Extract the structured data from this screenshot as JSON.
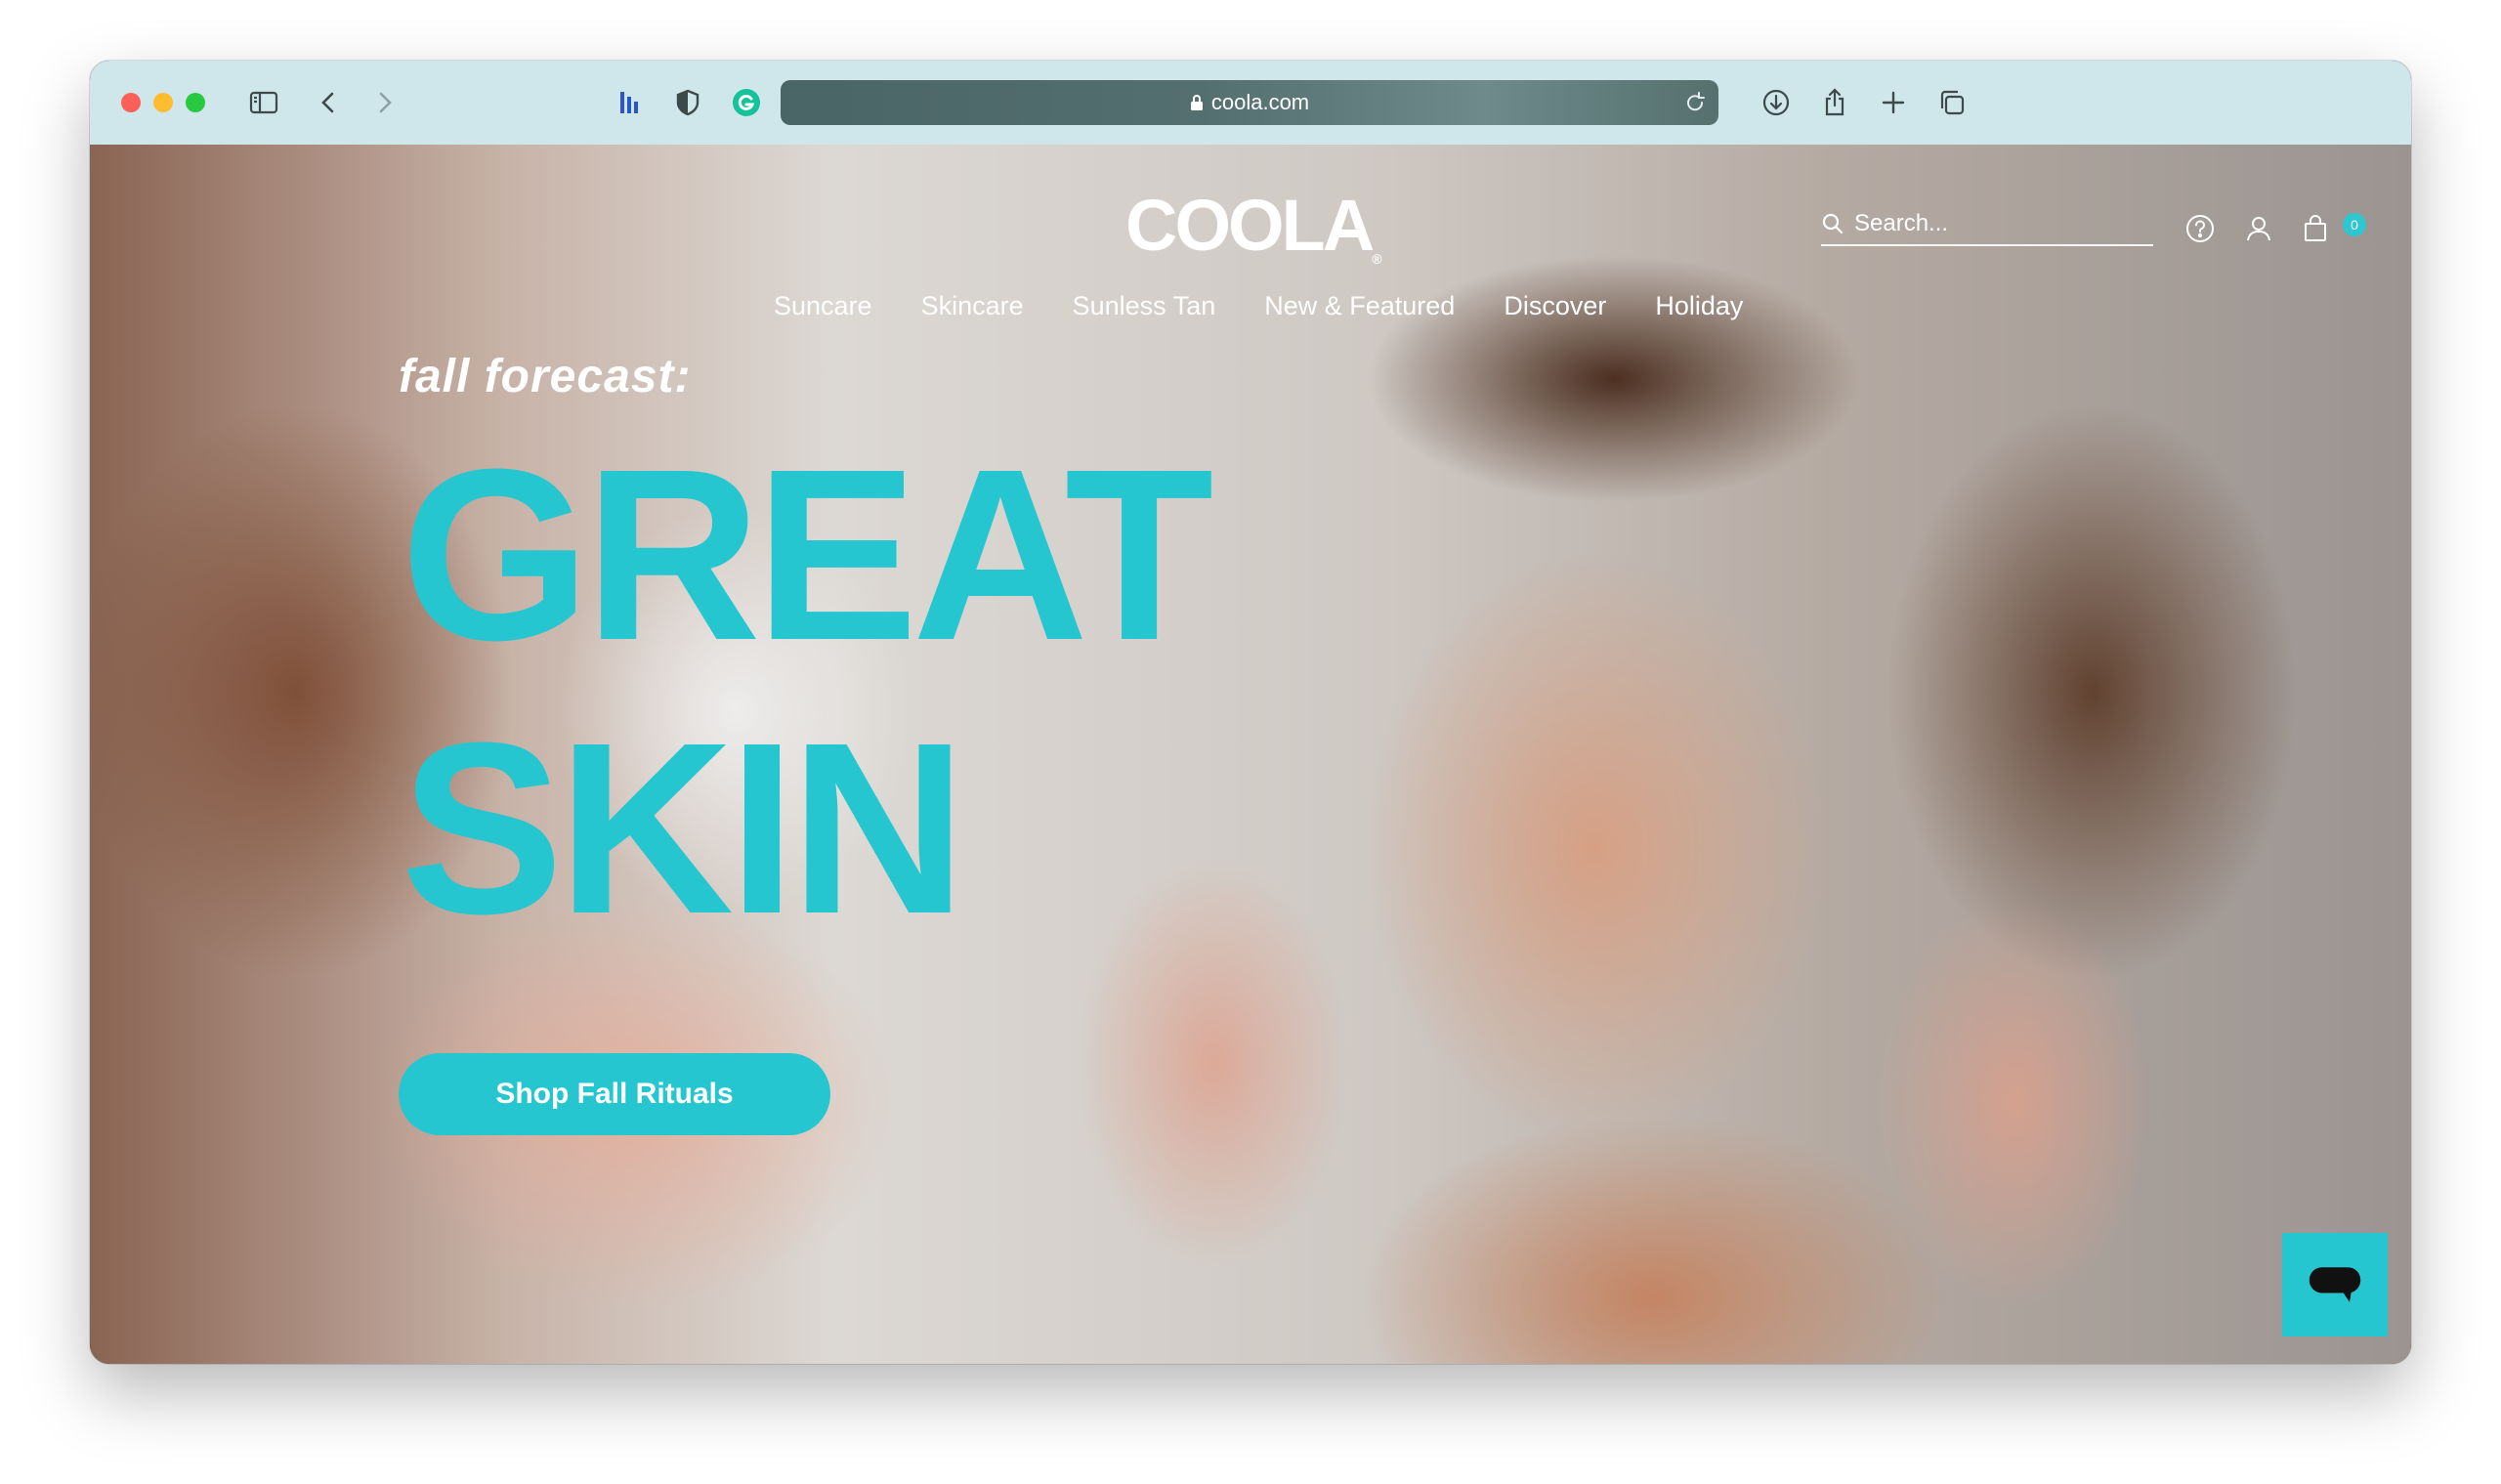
{
  "browser": {
    "url": "coola.com",
    "icons": [
      "sidebar-icon",
      "back-icon",
      "forward-icon",
      "extension-bars-icon",
      "privacy-shield-icon",
      "grammarly-icon",
      "lock-icon",
      "reload-icon",
      "download-icon",
      "share-icon",
      "new-tab-icon",
      "tab-overview-icon"
    ]
  },
  "site": {
    "logo": "COOLA",
    "logo_mark": "®",
    "nav": [
      "Suncare",
      "Skincare",
      "Sunless Tan",
      "New & Featured",
      "Discover",
      "Holiday"
    ],
    "search_placeholder": "Search...",
    "cart_count": "0",
    "header_icons": [
      "search-icon",
      "help-icon",
      "account-icon",
      "cart-icon"
    ]
  },
  "hero": {
    "kicker": "fall forecast:",
    "headline_line1": "GREAT",
    "headline_line2": "SKIN",
    "cta_label": "Shop Fall Rituals"
  },
  "chat": {
    "icon": "chat-bubble-icon"
  },
  "colors": {
    "accent": "#26c6d0",
    "toolbar": "#cfe6ea",
    "urlbar": "#4a6565",
    "white": "#ffffff"
  }
}
